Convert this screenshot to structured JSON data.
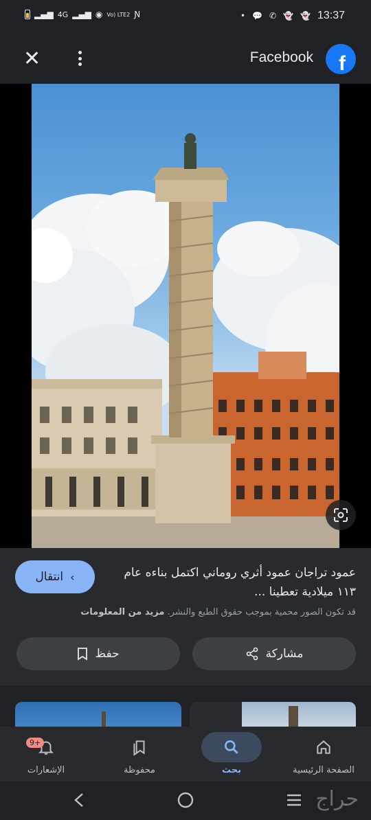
{
  "status_bar": {
    "network_label": "4G",
    "volte_label": "Vo) LTE2",
    "time": "13:37"
  },
  "header": {
    "source_name": "Facebook",
    "logo_letter": "f"
  },
  "info": {
    "visit_label": "انتقال",
    "title": "عمود تراجان عمود أثري روماني اكتمل بناءه عام ١١٣ ميلادية تعطينا ...",
    "copyright_text": "قد تكون الصور محمية بموجب حقوق الطبع والنشر.",
    "more_info_label": "مزيد من المعلومات",
    "share_label": "مشاركة",
    "save_label": "حفظ"
  },
  "bottom_nav": {
    "items": [
      {
        "label": "الصفحة الرئيسية",
        "icon": "home-icon"
      },
      {
        "label": "بحث",
        "icon": "search-icon",
        "active": true
      },
      {
        "label": "محفوظة",
        "icon": "bookmarks-icon"
      },
      {
        "label": "الإشعارات",
        "icon": "bell-icon",
        "badge": "9+"
      }
    ]
  },
  "watermark": "حراج",
  "colors": {
    "accent": "#8ab4f8",
    "facebook_blue": "#1877f2",
    "background": "#202124"
  }
}
